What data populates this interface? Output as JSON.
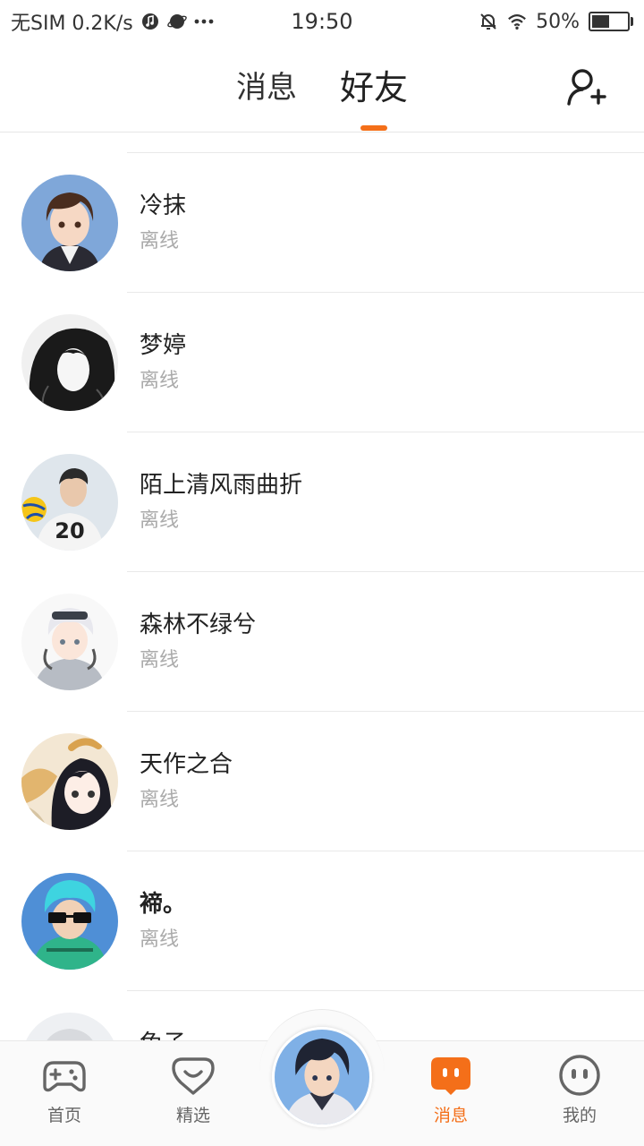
{
  "status_bar": {
    "left_text": "无SIM 0.2K/s",
    "time": "19:50",
    "battery": "50%",
    "battery_level": 0.5
  },
  "header": {
    "tabs": [
      {
        "label": "消息",
        "active": false
      },
      {
        "label": "好友",
        "active": true
      }
    ],
    "accent_color": "#f46f19"
  },
  "friends": [
    {
      "name": "冷抹",
      "status": "离线"
    },
    {
      "name": "梦婷",
      "status": "离线"
    },
    {
      "name": "陌上清风雨曲折",
      "status": "离线"
    },
    {
      "name": "森林不绿兮",
      "status": "离线"
    },
    {
      "name": "天作之合",
      "status": "离线"
    },
    {
      "name": "褅。",
      "status": "离线"
    },
    {
      "name": "兔子",
      "status": ""
    }
  ],
  "bottom_nav": {
    "items": [
      {
        "label": "首页",
        "icon": "gamepad-icon",
        "active": false
      },
      {
        "label": "精选",
        "icon": "heart-chat-icon",
        "active": false
      },
      {
        "label": "消息",
        "icon": "message-icon",
        "active": true
      },
      {
        "label": "我的",
        "icon": "face-icon",
        "active": false
      }
    ]
  }
}
